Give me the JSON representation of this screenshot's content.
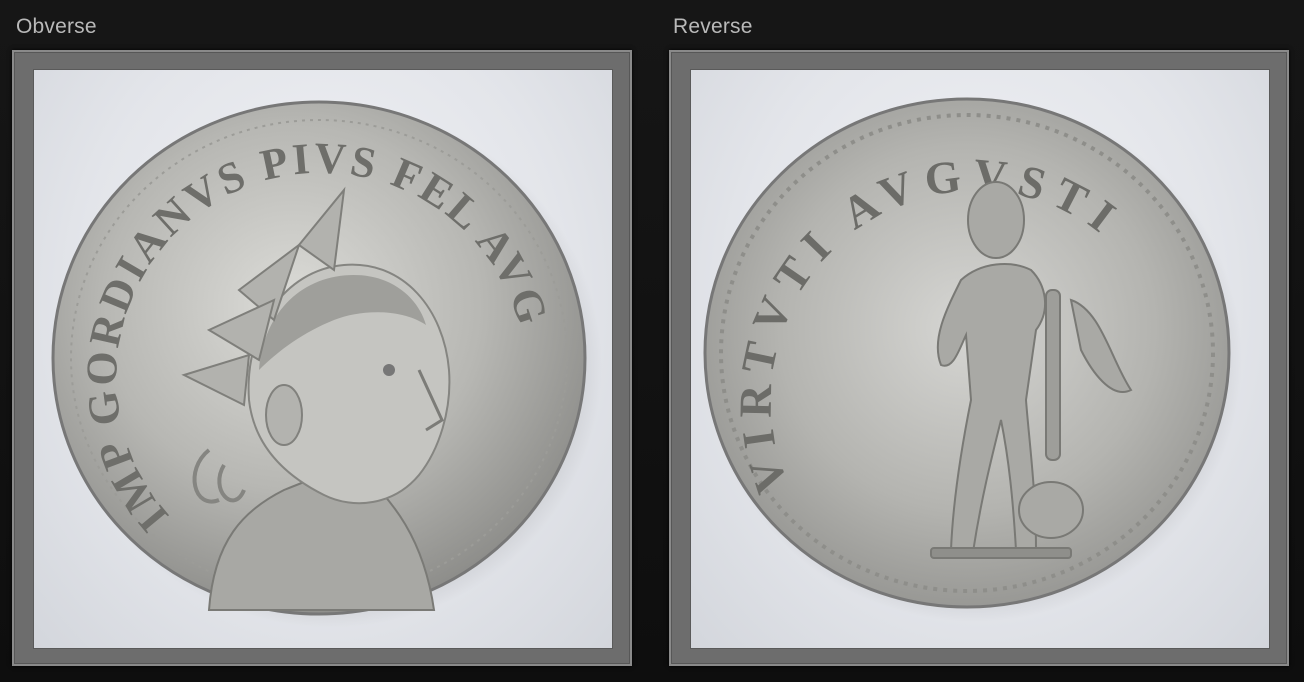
{
  "panels": {
    "obverse": {
      "label": "Obverse",
      "legend": "IMP GORDIANVS PIVS FEL AVG"
    },
    "reverse": {
      "label": "Reverse",
      "legend": "VIRTVTI AVGVSTI"
    }
  },
  "colors": {
    "background": "#121212",
    "frame": "#6d6d6d",
    "label": "#b9b9b9",
    "silver_light": "#d9d9d6",
    "silver_dark": "#8b8b88"
  }
}
